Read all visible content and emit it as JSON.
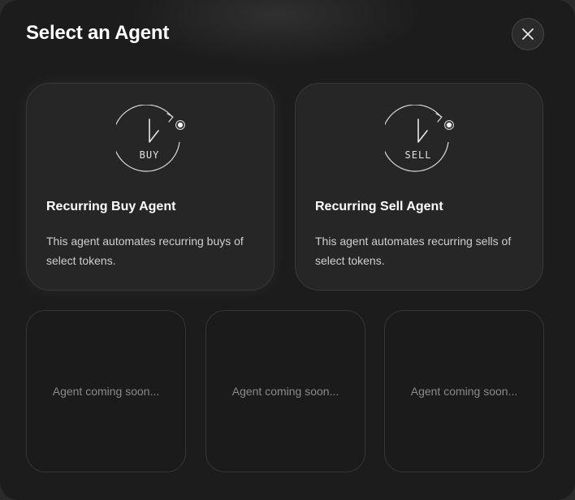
{
  "modal": {
    "title": "Select an Agent",
    "close_icon": "close-icon"
  },
  "agents": [
    {
      "icon_label": "BUY",
      "title": "Recurring Buy Agent",
      "description": "This agent automates recurring buys of select tokens."
    },
    {
      "icon_label": "SELL",
      "title": "Recurring Sell Agent",
      "description": "This agent automates recurring sells of select tokens."
    }
  ],
  "coming_soon": [
    {
      "label": "Agent coming soon..."
    },
    {
      "label": "Agent coming soon..."
    },
    {
      "label": "Agent coming soon..."
    }
  ],
  "colors": {
    "background": "#1c1c1c",
    "card": "#262626",
    "text": "#ffffff",
    "muted": "#8a8a8a"
  }
}
